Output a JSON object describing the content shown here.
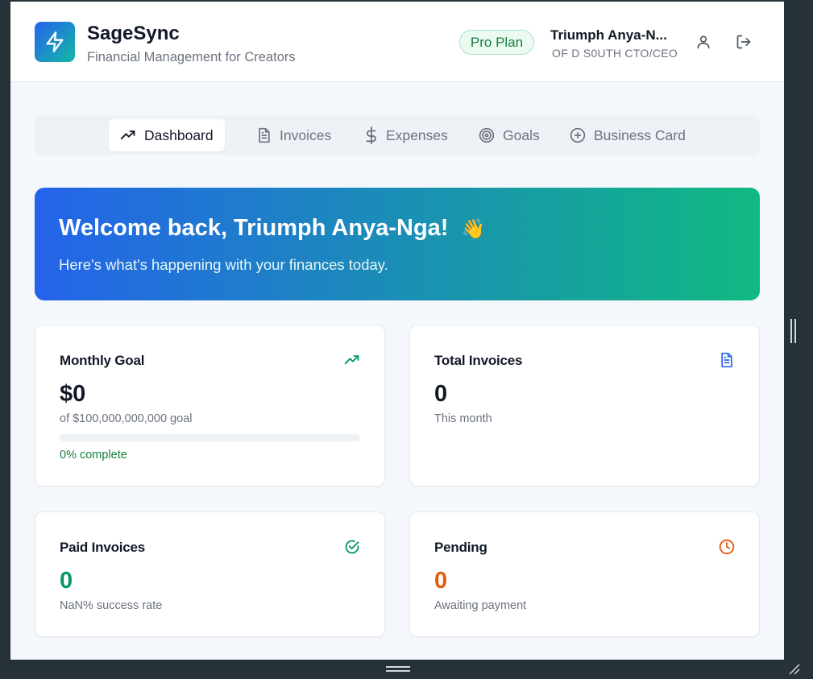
{
  "app": {
    "name": "SageSync",
    "tagline": "Financial Management for Creators",
    "plan_badge": "Pro Plan"
  },
  "user": {
    "name": "Triumph Anya-N...",
    "role": "OF D S0UTH CTO/CEO"
  },
  "tabs": [
    {
      "label": "Dashboard",
      "icon": "trending-up-icon",
      "active": true
    },
    {
      "label": "Invoices",
      "icon": "document-icon",
      "active": false
    },
    {
      "label": "Expenses",
      "icon": "dollar-icon",
      "active": false
    },
    {
      "label": "Goals",
      "icon": "target-icon",
      "active": false
    },
    {
      "label": "Business Card",
      "icon": "plus-circle-icon",
      "active": false
    }
  ],
  "welcome": {
    "title": "Welcome back, Triumph Anya-Nga!",
    "emoji": "👋",
    "subtitle": "Here's what's happening with your finances today."
  },
  "cards": {
    "monthly_goal": {
      "title": "Monthly Goal",
      "value": "$0",
      "note": "of $100,000,000,000 goal",
      "progress_percent": 0,
      "progress_label": "0% complete",
      "icon": "trending-up-icon"
    },
    "total_invoices": {
      "title": "Total Invoices",
      "value": "0",
      "note": "This month",
      "icon": "document-icon"
    },
    "paid_invoices": {
      "title": "Paid Invoices",
      "value": "0",
      "note": "NaN% success rate",
      "icon": "check-circle-icon"
    },
    "pending": {
      "title": "Pending",
      "value": "0",
      "note": "Awaiting payment",
      "icon": "clock-icon"
    }
  },
  "colors": {
    "accent_blue": "#2563eb",
    "accent_green": "#10b981",
    "success": "#15803d",
    "warning": "#ea580c",
    "background": "#f4f7fb"
  }
}
